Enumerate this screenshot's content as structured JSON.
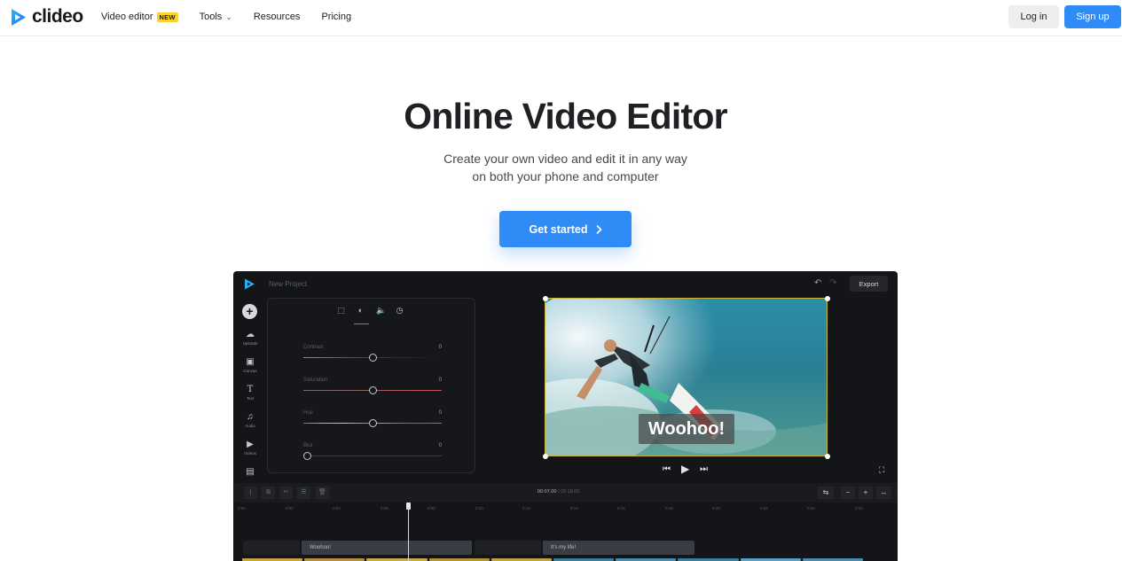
{
  "nav": {
    "logo": "clideo",
    "items": [
      {
        "label": "Video editor",
        "badge": "NEW"
      },
      {
        "label": "Tools",
        "has_chevron": true
      },
      {
        "label": "Resources"
      },
      {
        "label": "Pricing"
      }
    ],
    "login": "Log in",
    "signup": "Sign up"
  },
  "hero": {
    "title": "Online Video Editor",
    "subtitle_line1": "Create your own video and edit it in any way",
    "subtitle_line2": "on both your phone and computer",
    "cta": "Get started"
  },
  "editor": {
    "project_name": "New Project",
    "export_label": "Export",
    "sidebar": [
      {
        "label": "Uploads",
        "icon": "upload-icon"
      },
      {
        "label": "Canvas",
        "icon": "canvas-icon"
      },
      {
        "label": "Text",
        "icon": "text-icon"
      },
      {
        "label": "Audio",
        "icon": "audio-icon"
      },
      {
        "label": "Videos",
        "icon": "video-icon"
      },
      {
        "label": "",
        "icon": "image-icon"
      }
    ],
    "adjust": [
      {
        "label": "Contrast",
        "value": "0",
        "level": 0.5
      },
      {
        "label": "Saturation",
        "value": "0",
        "level": 0.5
      },
      {
        "label": "Hue",
        "value": "0",
        "level": 0.5
      },
      {
        "label": "Blur",
        "value": "0",
        "level": 0.0
      }
    ],
    "caption": "Woohoo!",
    "time_current": "00:07.00",
    "time_separator": "/",
    "time_total": "26:18.00",
    "ruler_ticks": [
      "0:00",
      "0:02",
      "0:04",
      "0:06",
      "0:08",
      "0:10",
      "0:12",
      "0:14",
      "0:16",
      "0:18",
      "0:20",
      "0:22",
      "0:24",
      "0:26"
    ],
    "text_tracks": [
      "Woohoo!",
      "It's my life!"
    ]
  },
  "colors": {
    "accent": "#2f8cf7",
    "badge": "#ffd426",
    "editor_bg": "#141518"
  }
}
